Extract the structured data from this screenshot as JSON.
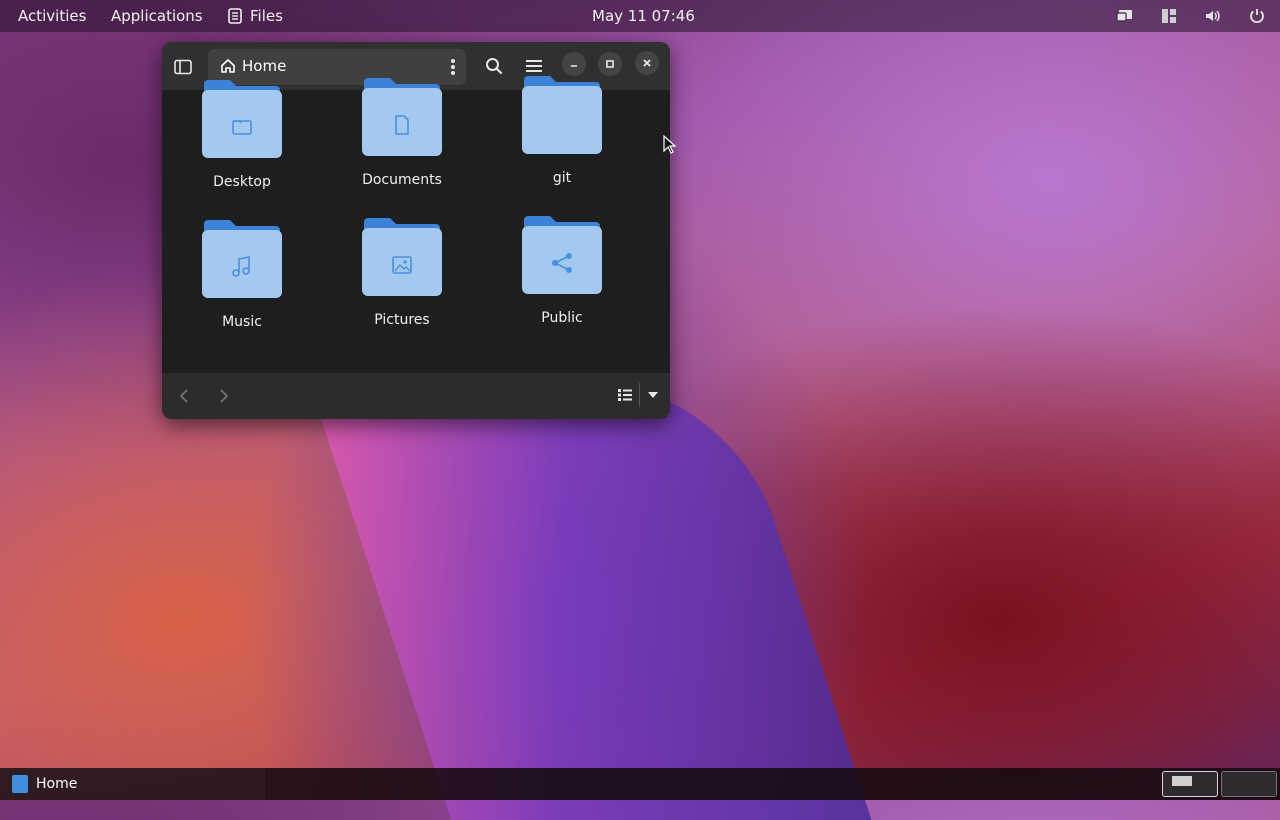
{
  "topbar": {
    "activities": "Activities",
    "applications": "Applications",
    "files": "Files",
    "clock": "May 11  07:46",
    "tray_icons": [
      "screen-share-icon",
      "workspace-icon",
      "volume-icon",
      "power-icon"
    ]
  },
  "window": {
    "path": {
      "label": "Home",
      "icon": "home-icon"
    },
    "header_icons": [
      "sidebar-toggle-icon",
      "path-menu-icon",
      "search-icon",
      "hamburger-menu-icon",
      "minimize-icon",
      "maximize-icon",
      "close-icon"
    ],
    "items": [
      {
        "label": "Desktop",
        "emblem": "folder-emblem-icon"
      },
      {
        "label": "Documents",
        "emblem": "document-emblem-icon"
      },
      {
        "label": "git",
        "emblem": ""
      },
      {
        "label": "Music",
        "emblem": "music-note-icon"
      },
      {
        "label": "Pictures",
        "emblem": "image-emblem-icon"
      },
      {
        "label": "Public",
        "emblem": "share-icon"
      }
    ],
    "footer_icons": [
      "back-icon",
      "forward-icon",
      "list-view-icon",
      "view-options-dropdown-icon"
    ]
  },
  "taskbar": {
    "item_label": "Home",
    "workspaces": 2,
    "active_workspace": 1
  },
  "colors": {
    "folder_body": "#a4c9f0",
    "folder_tab": "#3d82d9",
    "emblem": "#4a8fe0",
    "window_bg": "#1e1e1e",
    "header_bg": "#303030"
  }
}
